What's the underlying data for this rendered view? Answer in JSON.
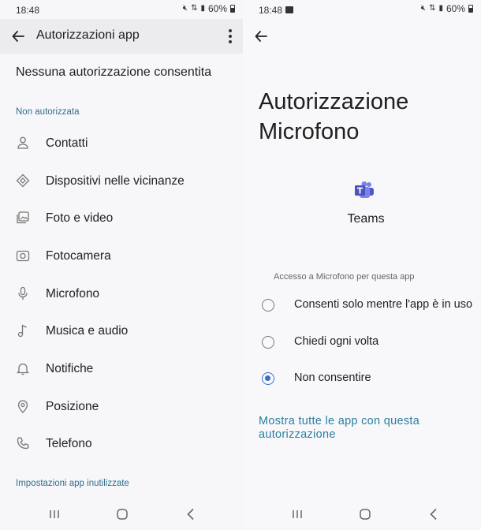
{
  "left": {
    "status": {
      "time": "18:48",
      "battery": "60%"
    },
    "appbar": {
      "title": "Autorizzazioni app"
    },
    "none_allowed": "Nessuna autorizzazione consentita",
    "section_not_authorized": "Non autorizzata",
    "permissions": [
      {
        "label": "Contatti",
        "icon": "person-icon"
      },
      {
        "label": "Dispositivi nelle vicinanze",
        "icon": "nearby-devices-icon"
      },
      {
        "label": "Foto e video",
        "icon": "photos-icon"
      },
      {
        "label": "Fotocamera",
        "icon": "camera-icon"
      },
      {
        "label": "Microfono",
        "icon": "microphone-icon"
      },
      {
        "label": "Musica e audio",
        "icon": "music-note-icon"
      },
      {
        "label": "Notifiche",
        "icon": "bell-icon"
      },
      {
        "label": "Posizione",
        "icon": "location-pin-icon"
      },
      {
        "label": "Telefono",
        "icon": "phone-icon"
      }
    ],
    "section_unused": "Impostazioni app inutilizzate"
  },
  "right": {
    "status": {
      "time": "18:48",
      "battery": "60%"
    },
    "title": "Autorizzazione Microfono",
    "app_name": "Teams",
    "access_header": "Accesso a Microfono per questa app",
    "options": [
      {
        "label": "Consenti solo mentre l'app è in uso",
        "selected": false
      },
      {
        "label": "Chiedi ogni volta",
        "selected": false
      },
      {
        "label": "Non consentire",
        "selected": true
      }
    ],
    "show_all_link": "Mostra tutte le app con questa autorizzazione"
  },
  "colors": {
    "accent": "#3a6fc9",
    "link": "#2a7e9e",
    "section": "#2f6f8f"
  }
}
